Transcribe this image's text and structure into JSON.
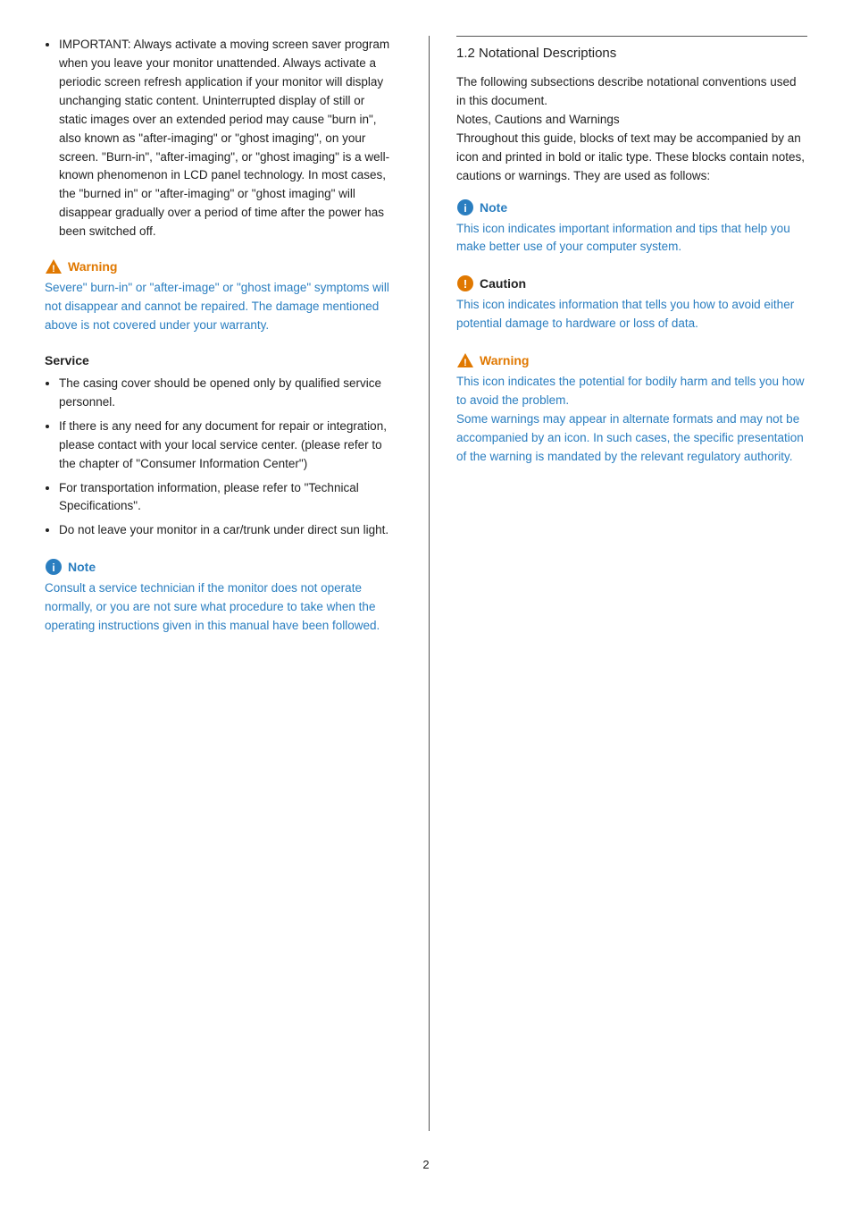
{
  "page": {
    "number": "2"
  },
  "left_col": {
    "bullet_intro": {
      "items": [
        "IMPORTANT: Always activate a moving screen saver program when you leave your monitor unattended. Always activate a periodic screen refresh application if your monitor will display unchanging static content. Uninterrupted display of still or static images over an extended period may cause \"burn in\", also known as \"after-imaging\" or \"ghost imaging\", on your screen. \"Burn-in\", \"after-imaging\", or \"ghost imaging\" is a well-known phenomenon in LCD panel technology. In most cases, the \"burned in\" or \"after-imaging\" or \"ghost imaging\" will disappear gradually over a period of time after the power has been switched off."
      ]
    },
    "warning1": {
      "icon_label": "⚠",
      "label": "Warning",
      "text": "Severe\" burn-in\" or \"after-image\" or \"ghost image\" symptoms will not disappear and cannot be repaired. The damage mentioned above is not covered under your warranty."
    },
    "service": {
      "title": "Service",
      "items": [
        "The casing cover should be opened only by qualified service personnel.",
        "If there is any need for any document for repair or integration, please contact with your local service center. (please refer to the chapter of \"Consumer Information Center\")",
        "For transportation information, please refer to \"Technical Specifications\".",
        "Do not leave your monitor in a car/trunk under direct sun light."
      ]
    },
    "note1": {
      "icon_label": "i",
      "label": "Note",
      "text": "Consult a service technician if the monitor does not operate normally, or you are not sure what procedure to take when the operating instructions given in this manual have been followed."
    }
  },
  "right_col": {
    "section_title": "1.2 Notational Descriptions",
    "intro_text": "The following subsections describe notational conventions used in this document.\nNotes, Cautions and Warnings\nThroughout this guide, blocks of text may be accompanied by an icon and printed in bold or italic type. These blocks contain notes, cautions or warnings. They are used as follows:",
    "note_box": {
      "icon_label": "i",
      "label": "Note",
      "text": "This icon indicates important information and tips that help you make better use of your computer system."
    },
    "caution_box": {
      "icon_label": "!",
      "label": "Caution",
      "text": "This icon indicates information that tells you how to avoid either potential damage to hardware or loss of data."
    },
    "warning_box": {
      "icon_label": "⚠",
      "label": "Warning",
      "text": "This icon indicates the potential for bodily harm and tells you how to avoid the problem.\nSome warnings may appear in alternate formats and may not be accompanied by an icon. In such cases, the specific presentation of the warning is mandated by the relevant regulatory authority."
    }
  }
}
